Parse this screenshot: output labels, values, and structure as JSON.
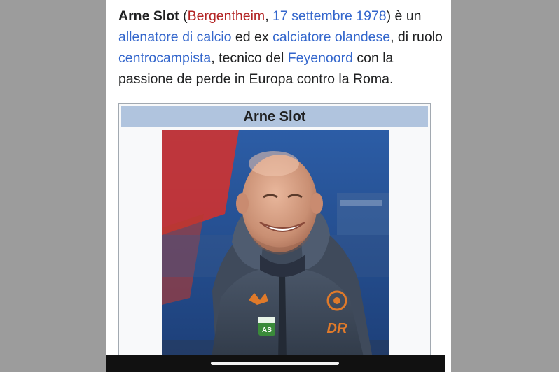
{
  "article": {
    "subject": "Arne Slot",
    "open_paren": " (",
    "birthplace": "Bergentheim",
    "comma": ", ",
    "birthdate": "17 settembre 1978",
    "after_date": ") è un ",
    "role_link": "allenatore di calcio",
    "mid_text": " ed ex ",
    "former_link": "calciatore olandese",
    "after_former": ", di ruolo ",
    "position_link": "centrocampista",
    "after_position": ", tecnico del ",
    "club_link": "Feyenoord",
    "ending": " con la passione de perde in Europa contro la Roma."
  },
  "infobox": {
    "title": "Arne Slot",
    "photo_crest_initials": "AS",
    "photo_sponsor_text": "DR"
  },
  "colors": {
    "red_link": "#b32424",
    "blue_link": "#3366cc",
    "infobox_header": "#b0c4de"
  }
}
